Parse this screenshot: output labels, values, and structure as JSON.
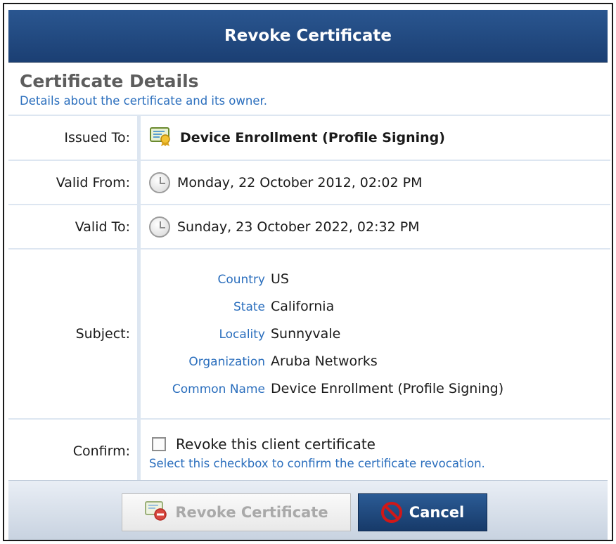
{
  "dialog": {
    "title": "Revoke Certificate"
  },
  "section": {
    "title": "Certificate Details",
    "subtitle": "Details about the certificate and its owner."
  },
  "rows": {
    "issued_to": {
      "label": "Issued To:",
      "value": "Device Enrollment (Profile Signing)",
      "icon": "certificate-icon"
    },
    "valid_from": {
      "label": "Valid From:",
      "value": "Monday, 22 October 2012, 02:02 PM",
      "icon": "clock-icon"
    },
    "valid_to": {
      "label": "Valid To:",
      "value": "Sunday, 23 October 2022, 02:32 PM",
      "icon": "clock-icon"
    },
    "subject": {
      "label": "Subject:",
      "fields": [
        {
          "key": "Country",
          "value": "US"
        },
        {
          "key": "State",
          "value": "California"
        },
        {
          "key": "Locality",
          "value": "Sunnyvale"
        },
        {
          "key": "Organization",
          "value": "Aruba Networks"
        },
        {
          "key": "Common Name",
          "value": "Device Enrollment (Profile Signing)"
        }
      ]
    },
    "confirm": {
      "label": "Confirm:",
      "checkbox_label": "Revoke this client certificate",
      "checked": false,
      "help": "Select this checkbox to confirm the certificate revocation."
    }
  },
  "buttons": {
    "revoke_label": "Revoke Certificate",
    "revoke_enabled": false,
    "cancel_label": "Cancel"
  },
  "colors": {
    "title_bar": "#1f4a80",
    "link_blue": "#2a6ebd",
    "heading_gray": "#5d5d5d",
    "cancel_icon_red": "#d01818"
  }
}
